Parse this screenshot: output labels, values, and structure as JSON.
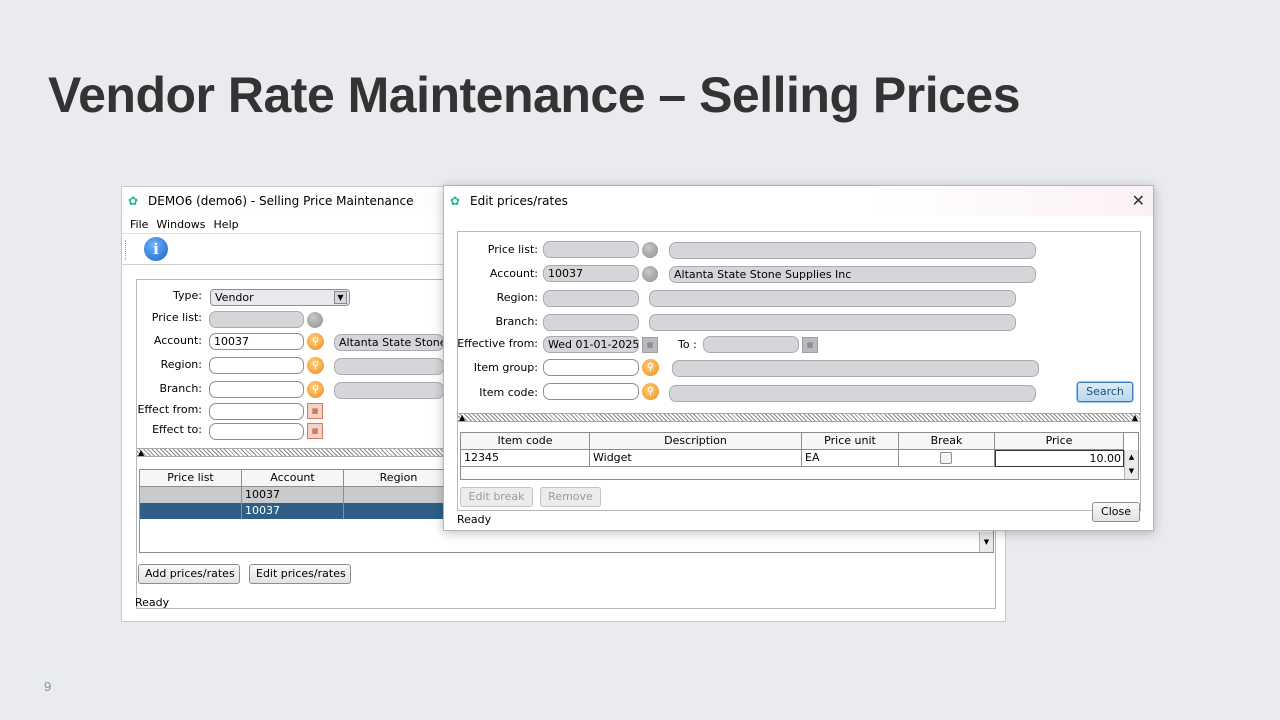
{
  "slide": {
    "title": "Vendor Rate Maintenance – Selling Prices",
    "page_number": "9"
  },
  "main_window": {
    "title": "DEMO6 (demo6) - Selling Price Maintenance",
    "menu": [
      "File",
      "Windows",
      "Help"
    ],
    "labels": {
      "type": "Type:",
      "price_list": "Price list:",
      "account": "Account:",
      "region": "Region:",
      "branch": "Branch:",
      "effect_from": "Effect from:",
      "effect_to": "Effect to:"
    },
    "fields": {
      "type": "Vendor",
      "price_list": "",
      "account": "10037",
      "account_name": "Altanta State Stone S",
      "region": "",
      "branch": "",
      "effect_from": "",
      "effect_to": ""
    },
    "grid": {
      "columns": [
        "Price list",
        "Account",
        "Region"
      ],
      "rows": [
        [
          "",
          "10037",
          ""
        ],
        [
          "",
          "10037",
          ""
        ]
      ]
    },
    "buttons": {
      "add": "Add prices/rates",
      "edit": "Edit prices/rates"
    },
    "status": "Ready"
  },
  "edit_window": {
    "title": "Edit prices/rates",
    "close_glyph": "✕",
    "labels": {
      "price_list": "Price list:",
      "account": "Account:",
      "region": "Region:",
      "branch": "Branch:",
      "effective_from": "Effective from:",
      "to": "To :",
      "item_group": "Item group:",
      "item_code": "Item code:"
    },
    "fields": {
      "price_list": "",
      "price_list_desc": "",
      "account": "10037",
      "account_name": "Altanta State Stone Supplies Inc",
      "region": "",
      "region_desc": "",
      "branch": "",
      "branch_desc": "",
      "effective_from": "Wed 01-01-2025",
      "to": "",
      "item_group": "",
      "item_group_desc": "",
      "item_code": "",
      "item_code_desc": ""
    },
    "search_button": "Search",
    "grid": {
      "columns": [
        "Item code",
        "Description",
        "Price unit",
        "Break",
        "Price"
      ],
      "rows": [
        {
          "item_code": "12345",
          "description": "Widget",
          "price_unit": "EA",
          "break": false,
          "price": "10.00"
        }
      ]
    },
    "buttons": {
      "edit_break": "Edit break",
      "remove": "Remove",
      "close": "Close"
    },
    "status": "Ready"
  }
}
